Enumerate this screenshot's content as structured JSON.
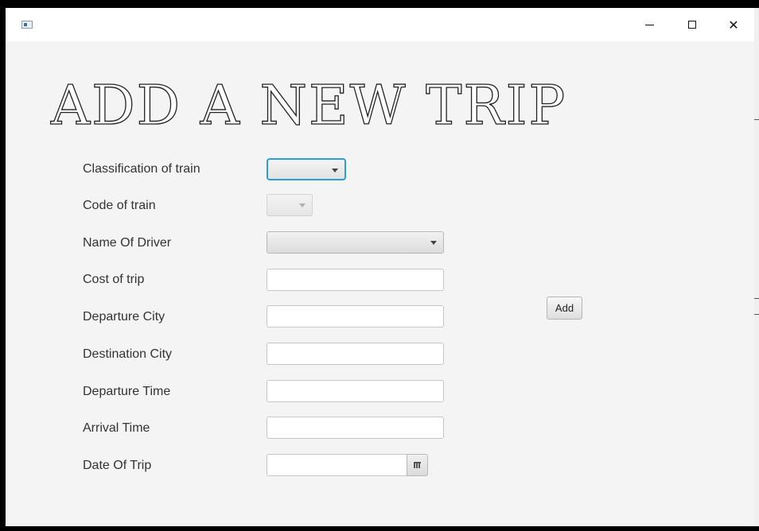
{
  "window": {
    "title": "",
    "controls": {
      "minimize_icon": "minimize-icon",
      "maximize_icon": "maximize-icon",
      "close_icon": "close-icon",
      "close_glyph": "✕"
    }
  },
  "page": {
    "title": "ADD A NEW TRIP"
  },
  "form": {
    "fields": [
      {
        "label": "Classification of train",
        "type": "combo",
        "value": ""
      },
      {
        "label": "Code of train",
        "type": "combo",
        "value": "",
        "disabled": true
      },
      {
        "label": "Name Of Driver",
        "type": "combo",
        "value": ""
      },
      {
        "label": "Cost of trip",
        "type": "text",
        "value": ""
      },
      {
        "label": "Departure City",
        "type": "text",
        "value": ""
      },
      {
        "label": "Destination City",
        "type": "text",
        "value": ""
      },
      {
        "label": "Departure Time",
        "type": "text",
        "value": ""
      },
      {
        "label": "Arrival Time",
        "type": "text",
        "value": ""
      },
      {
        "label": "Date Of Trip",
        "type": "date",
        "value": ""
      }
    ],
    "add_label": "Add",
    "date_picker_icon": "calendar-icon"
  },
  "colors": {
    "focus_border": "#2a9fd6",
    "window_bg": "#f4f4f4"
  }
}
